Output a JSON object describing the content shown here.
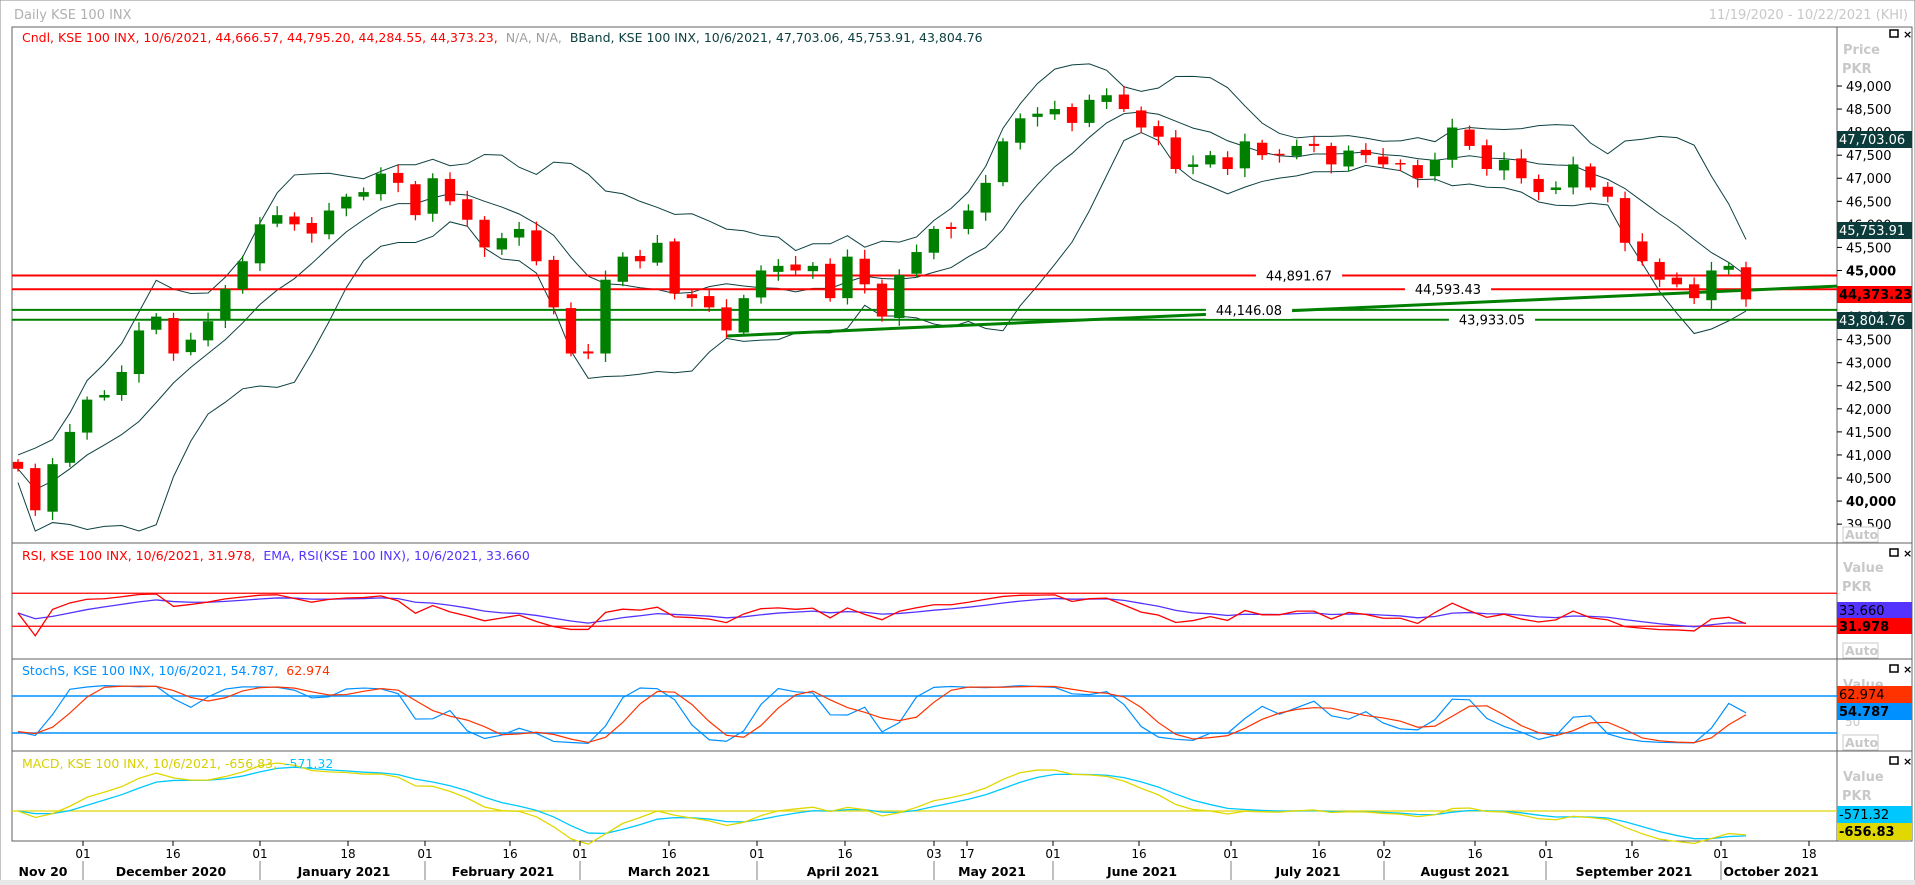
{
  "window": {
    "title": "Daily KSE 100 INX",
    "date_range": "11/19/2020 - 10/22/2021 (KHI)"
  },
  "legends": {
    "price": {
      "candle": "Cndl, KSE 100 INX, 10/6/2021, 44,666.57, 44,795.20, 44,284.55, 44,373.23,",
      "na": "N/A, N/A,",
      "bband": "BBand, KSE 100 INX, 10/6/2021, 47,703.06, 45,753.91, 43,804.76"
    },
    "rsi": {
      "rsi": "RSI, KSE 100 INX, 10/6/2021, 31.978,",
      "ema": "EMA, RSI(KSE 100 INX), 10/6/2021, 33.660"
    },
    "stoch": {
      "k": "StochS, KSE 100 INX, 10/6/2021, 54.787,",
      "d": "62.974"
    },
    "macd": {
      "macd": "MACD, KSE 100 INX, 10/6/2021, -656.83,",
      "signal": "-571.32"
    }
  },
  "axes": {
    "price_title": "Price",
    "price_unit": "PKR",
    "value_title": "Value",
    "auto": "Auto",
    "price_ticks": [
      "49,000",
      "48,500",
      "48,000",
      "47,500",
      "47,000",
      "46,500",
      "46,000",
      "45,500",
      "45,000",
      "44,500",
      "44,000",
      "43,500",
      "43,000",
      "42,500",
      "42,000",
      "41,500",
      "41,000",
      "40,500",
      "40,000",
      "39,500"
    ],
    "price_tick_values": [
      49000,
      48500,
      48000,
      47500,
      47000,
      46500,
      46000,
      45500,
      45000,
      44500,
      44000,
      43500,
      43000,
      42500,
      42000,
      41500,
      41000,
      40500,
      40000,
      39500
    ],
    "stoch_mid": "50",
    "day_ticks": [
      "01",
      "16",
      "01",
      "18",
      "01",
      "16",
      "01",
      "16",
      "01",
      "16",
      "03",
      "17",
      "01",
      "16",
      "01",
      "16",
      "02",
      "16",
      "01",
      "16",
      "01",
      "18"
    ],
    "months": [
      "Nov 20",
      "December 2020",
      "January 2021",
      "February 2021",
      "March 2021",
      "April 2021",
      "May 2021",
      "June 2021",
      "July 2021",
      "August 2021",
      "September 2021",
      "October 2021"
    ]
  },
  "badges": {
    "bb_upper": "47,703.06",
    "bb_mid": "45,753.91",
    "last": "44,373.23",
    "bb_lower": "43,804.76",
    "ema": "33.660",
    "rsi": "31.978",
    "stoch_d": "62.974",
    "stoch_k": "54.787",
    "signal": "-571.32",
    "macd": "-656.83"
  },
  "colors": {
    "up": "#008000",
    "down": "#ff0000",
    "band": "#0d4040",
    "rsi": "#ff0000",
    "rsi_ema": "#5533ff",
    "stoch_k": "#0090ff",
    "stoch_d": "#ff3300",
    "macd": "#e0d800",
    "signal": "#00c8ff",
    "badge_dark": "#0b3b3b"
  },
  "chart_data": {
    "type": "candlestick",
    "title": "Daily KSE 100 INX",
    "ylabel": "Price PKR",
    "ylim": [
      39300,
      49600
    ],
    "closes": [
      40700,
      39800,
      40800,
      41500,
      42200,
      42300,
      42800,
      43700,
      44000,
      43200,
      43500,
      43900,
      44600,
      45200,
      46000,
      46200,
      46000,
      45800,
      46300,
      46600,
      46700,
      47100,
      46900,
      46200,
      47000,
      46500,
      46100,
      45500,
      45700,
      45900,
      45200,
      44200,
      43200,
      43200,
      44800,
      45300,
      45200,
      45600,
      44500,
      44400,
      44200,
      43700,
      44400,
      45000,
      45100,
      45000,
      45100,
      44400,
      45300,
      44700,
      44000,
      44900,
      45400,
      45900,
      45900,
      46300,
      46900,
      47800,
      48300,
      48400,
      48500,
      48200,
      48700,
      48800,
      48500,
      48100,
      47900,
      47200,
      47300,
      47500,
      47200,
      47800,
      47500,
      47500,
      47700,
      47700,
      47300,
      47600,
      47500,
      47300,
      47300,
      47000,
      47400,
      48100,
      47700,
      47200,
      47400,
      47000,
      46700,
      46800,
      47300,
      46800,
      46600,
      45600,
      45200,
      44800,
      44700,
      44400,
      45000,
      45100,
      44373
    ],
    "horizontal_lines": [
      {
        "label": "44,891.67",
        "value": 44891.67,
        "color": "#ff0000"
      },
      {
        "label": "44,593.43",
        "value": 44593.43,
        "color": "#ff0000"
      },
      {
        "label": "44,146.08",
        "value": 44146.08,
        "color": "#008000"
      },
      {
        "label": "43,933.05",
        "value": 43933.05,
        "color": "#008000"
      }
    ],
    "trendline": {
      "start_index": 41,
      "start_value": 43580,
      "end_value": 44660,
      "color": "#008000"
    },
    "rsi_levels": [
      70,
      30
    ],
    "stoch_levels": [
      80,
      20
    ]
  }
}
